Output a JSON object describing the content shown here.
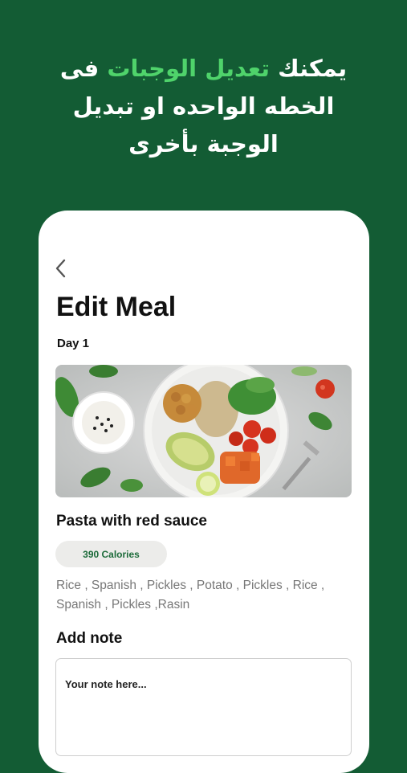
{
  "headline": {
    "line1_prefix": "يمكنك ",
    "line1_highlight": "تعديل الوجبات",
    "line1_suffix": " فى",
    "line2": "الخطه الواحده او تبديل",
    "line3": "الوجبة بأخرى"
  },
  "colors": {
    "background": "#135c34",
    "highlight": "#4fd36b",
    "calorie_text": "#1c6b3a"
  },
  "screen": {
    "back_icon": "chevron-left-icon",
    "title": "Edit Meal",
    "day_label": "Day 1",
    "image_alt": "meal-bowl-image",
    "meal_name": "Pasta with red sauce",
    "calories": "390 Calories",
    "ingredients": "Rice , Spanish , Pickles , Potato , Pickles , Rice , Spanish , Pickles ,Rasin",
    "add_note_label": "Add note",
    "note_placeholder": "Your note here..."
  }
}
